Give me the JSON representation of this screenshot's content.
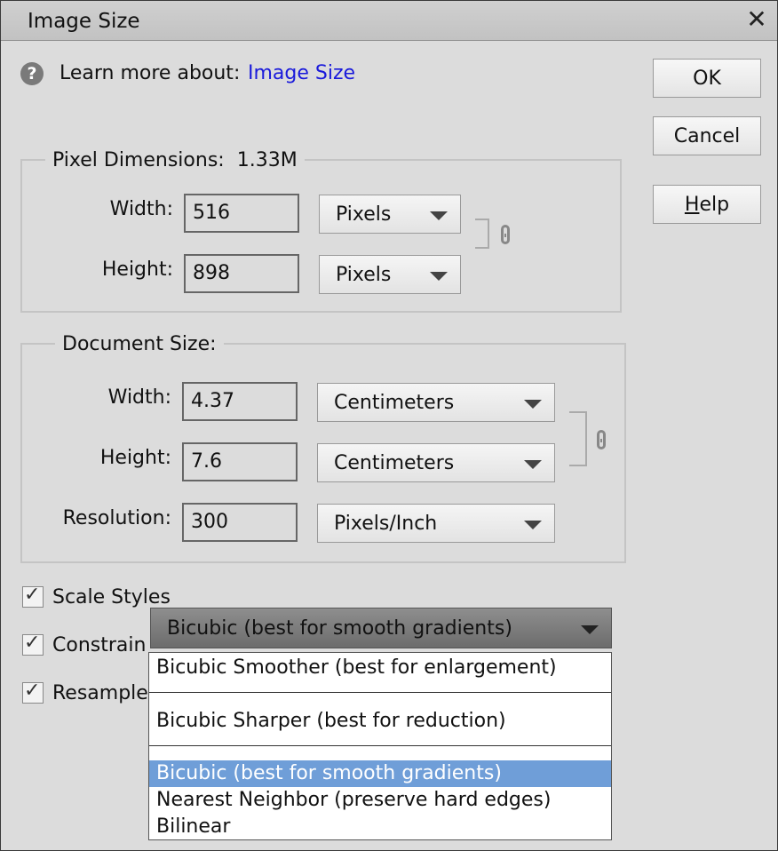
{
  "window": {
    "title": "Image Size"
  },
  "learn": {
    "prefix": "Learn more about:",
    "link": "Image Size"
  },
  "buttons": {
    "ok": "OK",
    "cancel": "Cancel",
    "help": "Help"
  },
  "pixel_dimensions": {
    "label": "Pixel Dimensions:",
    "size": "1.33M",
    "width_label": "Width:",
    "width_value": "516",
    "width_unit": "Pixels",
    "height_label": "Height:",
    "height_value": "898",
    "height_unit": "Pixels"
  },
  "document_size": {
    "label": "Document Size:",
    "width_label": "Width:",
    "width_value": "4.37",
    "width_unit": "Centimeters",
    "height_label": "Height:",
    "height_value": "7.6",
    "height_unit": "Centimeters",
    "resolution_label": "Resolution:",
    "resolution_value": "300",
    "resolution_unit": "Pixels/Inch"
  },
  "checkboxes": {
    "scale_styles": {
      "label": "Scale Styles",
      "checked": true
    },
    "constrain": {
      "label": "Constrain",
      "checked": true
    },
    "resample": {
      "label": "Resample",
      "checked": true
    }
  },
  "resample_method": {
    "selected": "Bicubic (best for smooth gradients)",
    "options": [
      "Bicubic Smoother (best for enlargement)",
      "Bicubic Sharper (best for reduction)",
      "Bicubic (best for smooth gradients)",
      "Nearest Neighbor (preserve hard edges)",
      "Bilinear"
    ]
  },
  "colors": {
    "link": "#1a1adb",
    "highlight": "#6f9ed8"
  }
}
